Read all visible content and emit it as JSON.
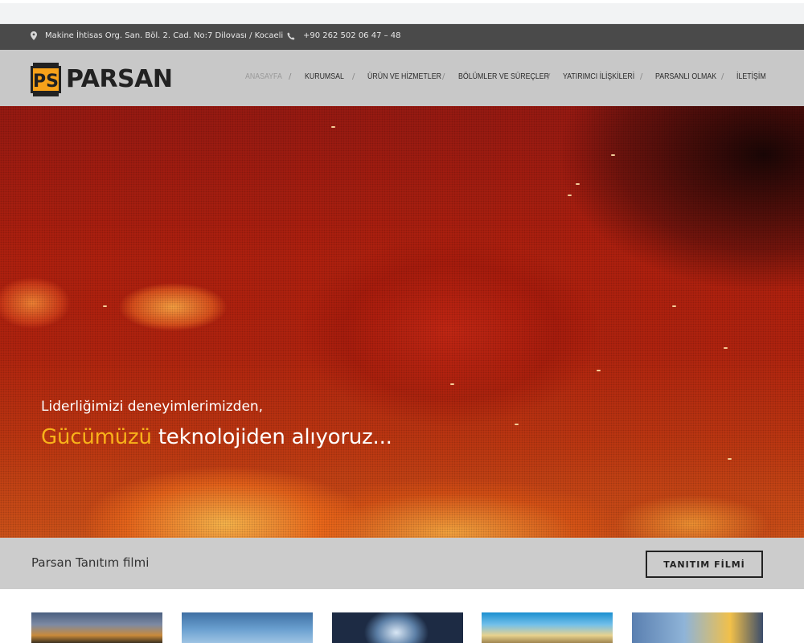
{
  "topbar": {
    "address": "Makine İhtisas Org. San. Böl. 2. Cad. No:7 Dilovası / Kocaeli",
    "phone": "+90 262 502 06 47 – 48",
    "address_icon": "map-marker-icon",
    "phone_icon": "phone-icon"
  },
  "brand": {
    "badge_text": "PS",
    "name": "PARSAN",
    "badge_color": "#f8a21a",
    "badge_border": "#222222"
  },
  "nav": {
    "items": [
      {
        "label": "ANASAYFA",
        "active": true
      },
      {
        "label": "KURUMSAL",
        "active": false
      },
      {
        "label": "ÜRÜN VE HİZMETLER",
        "active": false
      },
      {
        "label": "BÖLÜMLER VE SÜREÇLER",
        "active": false
      },
      {
        "label": "YATIRIMCI İLİŞKİLERİ",
        "active": false
      },
      {
        "label": "PARSANLI OLMAK",
        "active": false
      },
      {
        "label": "İLETİŞİM",
        "active": false
      }
    ],
    "separator": "/"
  },
  "hero": {
    "line1": "Liderliğimizi deneyimlerimizden,",
    "line2_accent": "Gücümüzü",
    "line2_rest": "teknolojiden alıyoruz...",
    "accent_color": "#f8b21a"
  },
  "cta": {
    "label": "Parsan Tanıtım filmi",
    "button": "TANITIM FİLMİ"
  },
  "thumbnails": [
    {
      "name": "thumbnail-1"
    },
    {
      "name": "thumbnail-2"
    },
    {
      "name": "thumbnail-3"
    },
    {
      "name": "thumbnail-4"
    },
    {
      "name": "thumbnail-5"
    }
  ]
}
